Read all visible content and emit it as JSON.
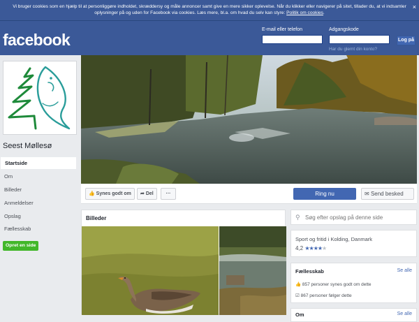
{
  "cookie_bar": {
    "text": "Vi bruger cookies som en hjælp til at personliggøre indholdet, skræddersy og måle annoncer samt give en mere sikker oplevelse. Når du klikker eller navigerer på sitet, tillader du, at vi indsamler oplysninger på og uden for Facebook via cookies. Læs mere, bl.a. om hvad du selv kan styre:",
    "link": "Politik om cookies",
    "close": "×"
  },
  "header": {
    "logo": "facebook",
    "email_label": "E-mail eller telefon",
    "password_label": "Adgangskode",
    "forgot_link": "Har du glemt din konto?",
    "login_button": "Log på"
  },
  "sidebar": {
    "page_name": "Seest Møllesø",
    "nav": [
      {
        "label": "Startside"
      },
      {
        "label": "Om"
      },
      {
        "label": "Billeder"
      },
      {
        "label": "Anmeldelser"
      },
      {
        "label": "Opslag"
      },
      {
        "label": "Fællesskab"
      }
    ],
    "create_page": "Opret en side"
  },
  "actions": {
    "like": "Synes godt om",
    "share": "Del",
    "more": "···",
    "call": "Ring nu",
    "message": "Send besked"
  },
  "photos": {
    "title": "Billeder"
  },
  "right": {
    "search_placeholder": "Søg efter opslag på denne side",
    "category": "Sport og fritid i Kolding, Danmark",
    "rating": "4,2",
    "rating_value": 4.2,
    "community_title": "Fællesskab",
    "see_all": "Se alle",
    "likes": "857 personer synes godt om dette",
    "follows": "867 personer følger dette",
    "about_title": "Om",
    "about_see_all": "Se alle"
  },
  "colors": {
    "brand": "#3b5998",
    "primary_button": "#4267b2",
    "create_green": "#42b72a"
  }
}
